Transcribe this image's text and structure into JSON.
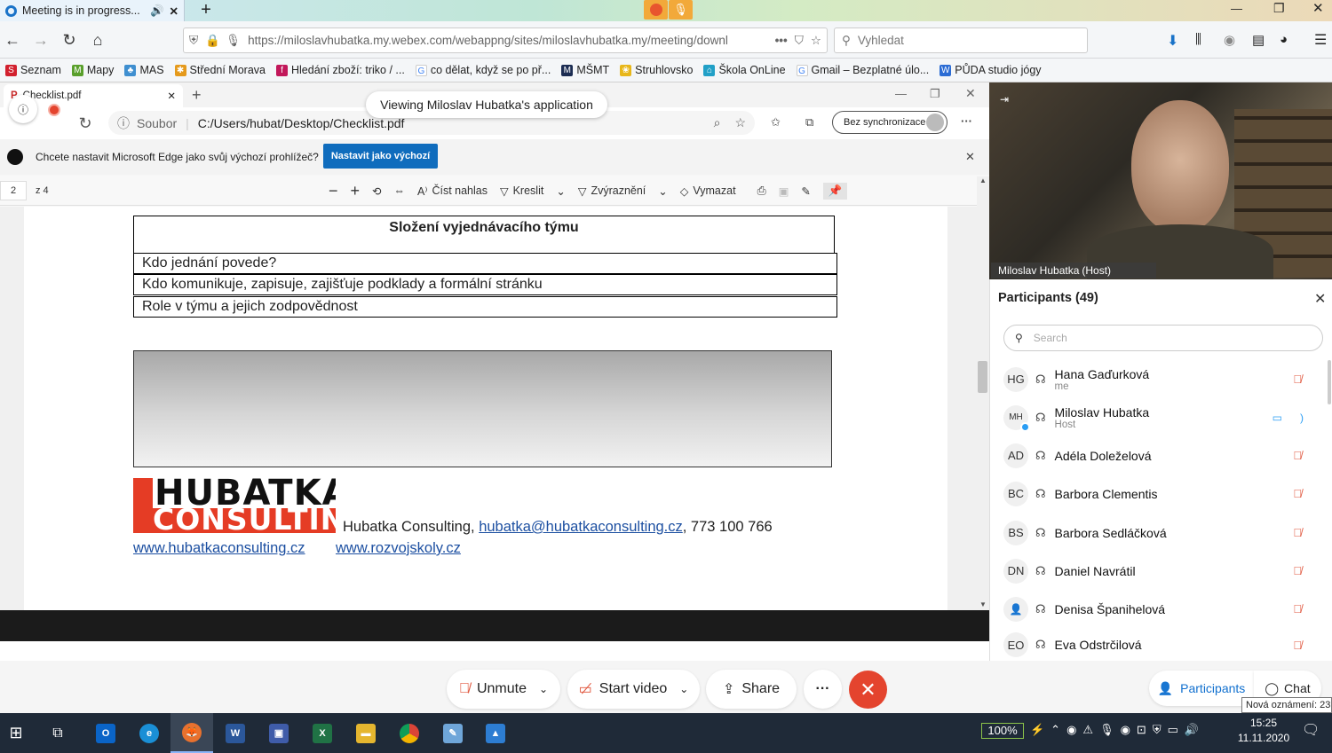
{
  "firefox": {
    "tab_title": "Meeting is in progress...",
    "url": "https://miloslavhubatka.my.webex.com/webappng/sites/miloslavhubatka.my/meeting/downl",
    "search_placeholder": "Vyhledat",
    "bookmarks": [
      "Seznam",
      "Mapy",
      "MAS",
      "Střední Morava",
      "Hledání zboží: triko / ...",
      "co dělat, když se po př...",
      "MŠMT",
      "Struhlovsko",
      "Škola OnLine",
      "Gmail – Bezplatné úlo...",
      "PŮDA studio jógy"
    ]
  },
  "edge": {
    "tab_title": "Checklist.pdf",
    "address_prefix": "Soubor",
    "address": "C:/Users/hubat/Desktop/Checklist.pdf",
    "sync_label": "Bez synchronizace",
    "infobar_text": "Chcete nastavit Microsoft Edge jako svůj výchozí prohlížeč?",
    "set_default_label": "Nastavit jako výchozí",
    "page_number": "2",
    "page_total": "z 4",
    "tools": {
      "read_aloud": "Číst nahlas",
      "draw": "Kreslit",
      "highlight": "Zvýraznění",
      "erase": "Vymazat"
    }
  },
  "viewing_banner": "Viewing Miloslav Hubatka's application",
  "document": {
    "heading": "Složení vyjednávacího týmu",
    "rows": [
      "Kdo jednání povede?",
      "Kdo komunikuje, zapisuje, zajišťuje podklady a formální stránku",
      "Role v týmu a jejich zodpovědnost"
    ],
    "logo_line1": "HUBATKA",
    "logo_line2": "CONSULTING",
    "contact_prefix": "Hubatka Consulting,",
    "email": "hubatka@hubatkaconsulting.cz",
    "phone": ", 773 100 766",
    "website1": "www.hubatkaconsulting.cz",
    "website2": "www.rozvojskoly.cz"
  },
  "video": {
    "name": "Miloslav Hubatka",
    "role": "(Host)"
  },
  "participants": {
    "title": "Participants (49)",
    "search_placeholder": "Search",
    "list": [
      {
        "initials": "HG",
        "name": "Hana Gaďurková",
        "sub": "me"
      },
      {
        "initials": "MH",
        "name": "Miloslav Hubatka",
        "sub": "Host"
      },
      {
        "initials": "AD",
        "name": "Adéla Doleželová",
        "sub": ""
      },
      {
        "initials": "BC",
        "name": "Barbora Clementis",
        "sub": ""
      },
      {
        "initials": "BS",
        "name": "Barbora Sedláčková",
        "sub": ""
      },
      {
        "initials": "DN",
        "name": "Daniel Navrátil",
        "sub": ""
      },
      {
        "initials": "",
        "name": "Denisa Španihelová",
        "sub": ""
      },
      {
        "initials": "EO",
        "name": "Eva Odstrčilová",
        "sub": ""
      }
    ]
  },
  "controls": {
    "unmute": "Unmute",
    "start_video": "Start video",
    "share": "Share",
    "more": "···",
    "participants": "Participants",
    "chat": "Chat"
  },
  "tooltip": "Nová oznámení: 23",
  "taskbar": {
    "battery": "100%",
    "time": "15:25",
    "date": "11.11.2020"
  },
  "colors": {
    "webex_end": "#e4442e",
    "edge_blue": "#0f6cbd",
    "link": "#1c4fa1",
    "mute_red": "#e0553c"
  }
}
